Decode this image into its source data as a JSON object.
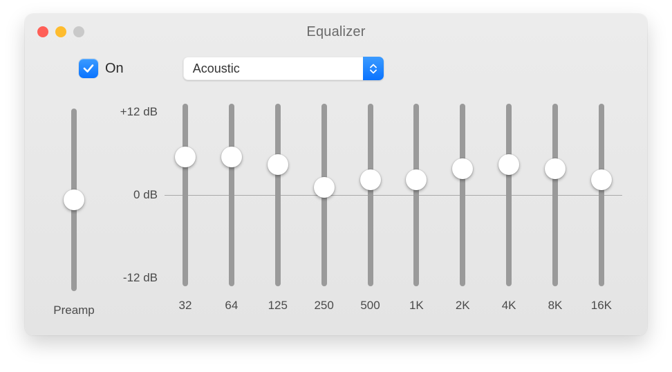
{
  "window": {
    "title": "Equalizer"
  },
  "header": {
    "on_checked": true,
    "on_label": "On",
    "preset": "Acoustic"
  },
  "scale": {
    "max_label": "+12 dB",
    "mid_label": "0 dB",
    "min_label": "-12 dB"
  },
  "preamp": {
    "label": "Preamp",
    "value_db": 0
  },
  "bands": [
    {
      "freq_label": "32",
      "value_db": 5.0
    },
    {
      "freq_label": "64",
      "value_db": 5.0
    },
    {
      "freq_label": "125",
      "value_db": 4.0
    },
    {
      "freq_label": "250",
      "value_db": 1.0
    },
    {
      "freq_label": "500",
      "value_db": 2.0
    },
    {
      "freq_label": "1K",
      "value_db": 2.0
    },
    {
      "freq_label": "2K",
      "value_db": 3.5
    },
    {
      "freq_label": "4K",
      "value_db": 4.0
    },
    {
      "freq_label": "8K",
      "value_db": 3.5
    },
    {
      "freq_label": "16K",
      "value_db": 2.0
    }
  ],
  "range_db": {
    "min": -12,
    "max": 12
  }
}
